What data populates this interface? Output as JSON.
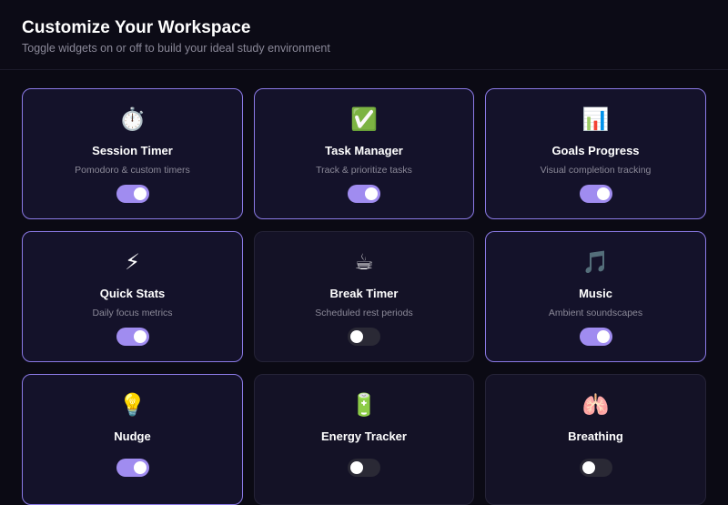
{
  "header": {
    "title": "Customize Your Workspace",
    "subtitle": "Toggle widgets on or off to build your ideal study environment"
  },
  "widgets": [
    {
      "icon": "⏱️",
      "icon_name": "stopwatch-icon",
      "title": "Session Timer",
      "description": "Pomodoro & custom timers",
      "enabled": true
    },
    {
      "icon": "✅",
      "icon_name": "check-mark-icon",
      "title": "Task Manager",
      "description": "Track & prioritize tasks",
      "enabled": true
    },
    {
      "icon": "📊",
      "icon_name": "bar-chart-icon",
      "title": "Goals Progress",
      "description": "Visual completion tracking",
      "enabled": true
    },
    {
      "icon": "⚡",
      "icon_name": "lightning-icon",
      "title": "Quick Stats",
      "description": "Daily focus metrics",
      "enabled": true
    },
    {
      "icon": "☕",
      "icon_name": "coffee-icon",
      "title": "Break Timer",
      "description": "Scheduled rest periods",
      "enabled": false
    },
    {
      "icon": "🎵",
      "icon_name": "music-note-icon",
      "title": "Music",
      "description": "Ambient soundscapes",
      "enabled": true
    },
    {
      "icon": "💡",
      "icon_name": "lightbulb-icon",
      "title": "Nudge",
      "description": "",
      "enabled": true
    },
    {
      "icon": "🔋",
      "icon_name": "battery-icon",
      "title": "Energy Tracker",
      "description": "",
      "enabled": false
    },
    {
      "icon": "🫁",
      "icon_name": "lungs-icon",
      "title": "Breathing",
      "description": "",
      "enabled": false
    }
  ],
  "colors": {
    "accent": "#a08cf0",
    "card_border_on": "#8b7ae6",
    "card_bg": "#141226",
    "page_bg": "#0b0a14"
  }
}
